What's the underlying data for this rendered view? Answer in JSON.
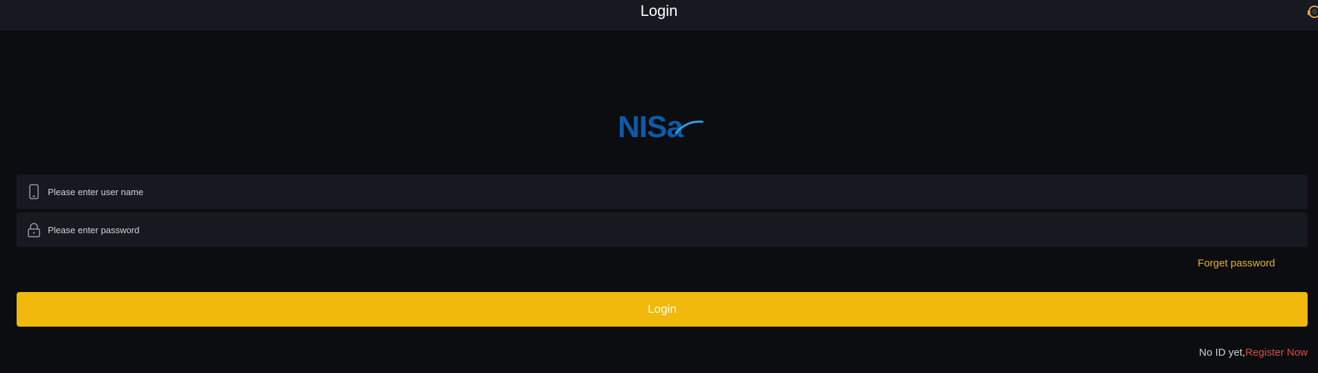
{
  "header": {
    "title": "Login",
    "support_icon": "customer-service-icon"
  },
  "logo": {
    "text": "NISa",
    "color": "#0d5aa7",
    "accent": "#2aa6df"
  },
  "form": {
    "username": {
      "icon": "phone-icon",
      "placeholder": "Please enter user name",
      "value": ""
    },
    "password": {
      "icon": "lock-icon",
      "placeholder": "Please enter password",
      "value": ""
    },
    "forgot_label": "Forget password",
    "login_label": "Login"
  },
  "register": {
    "prefix": "No ID yet,",
    "link": "Register Now"
  },
  "colors": {
    "background": "#0b0d11",
    "header": "#171921",
    "field": "#171921",
    "primary": "#f0b90b",
    "link": "#e8b32a",
    "register": "#e54b3c"
  }
}
